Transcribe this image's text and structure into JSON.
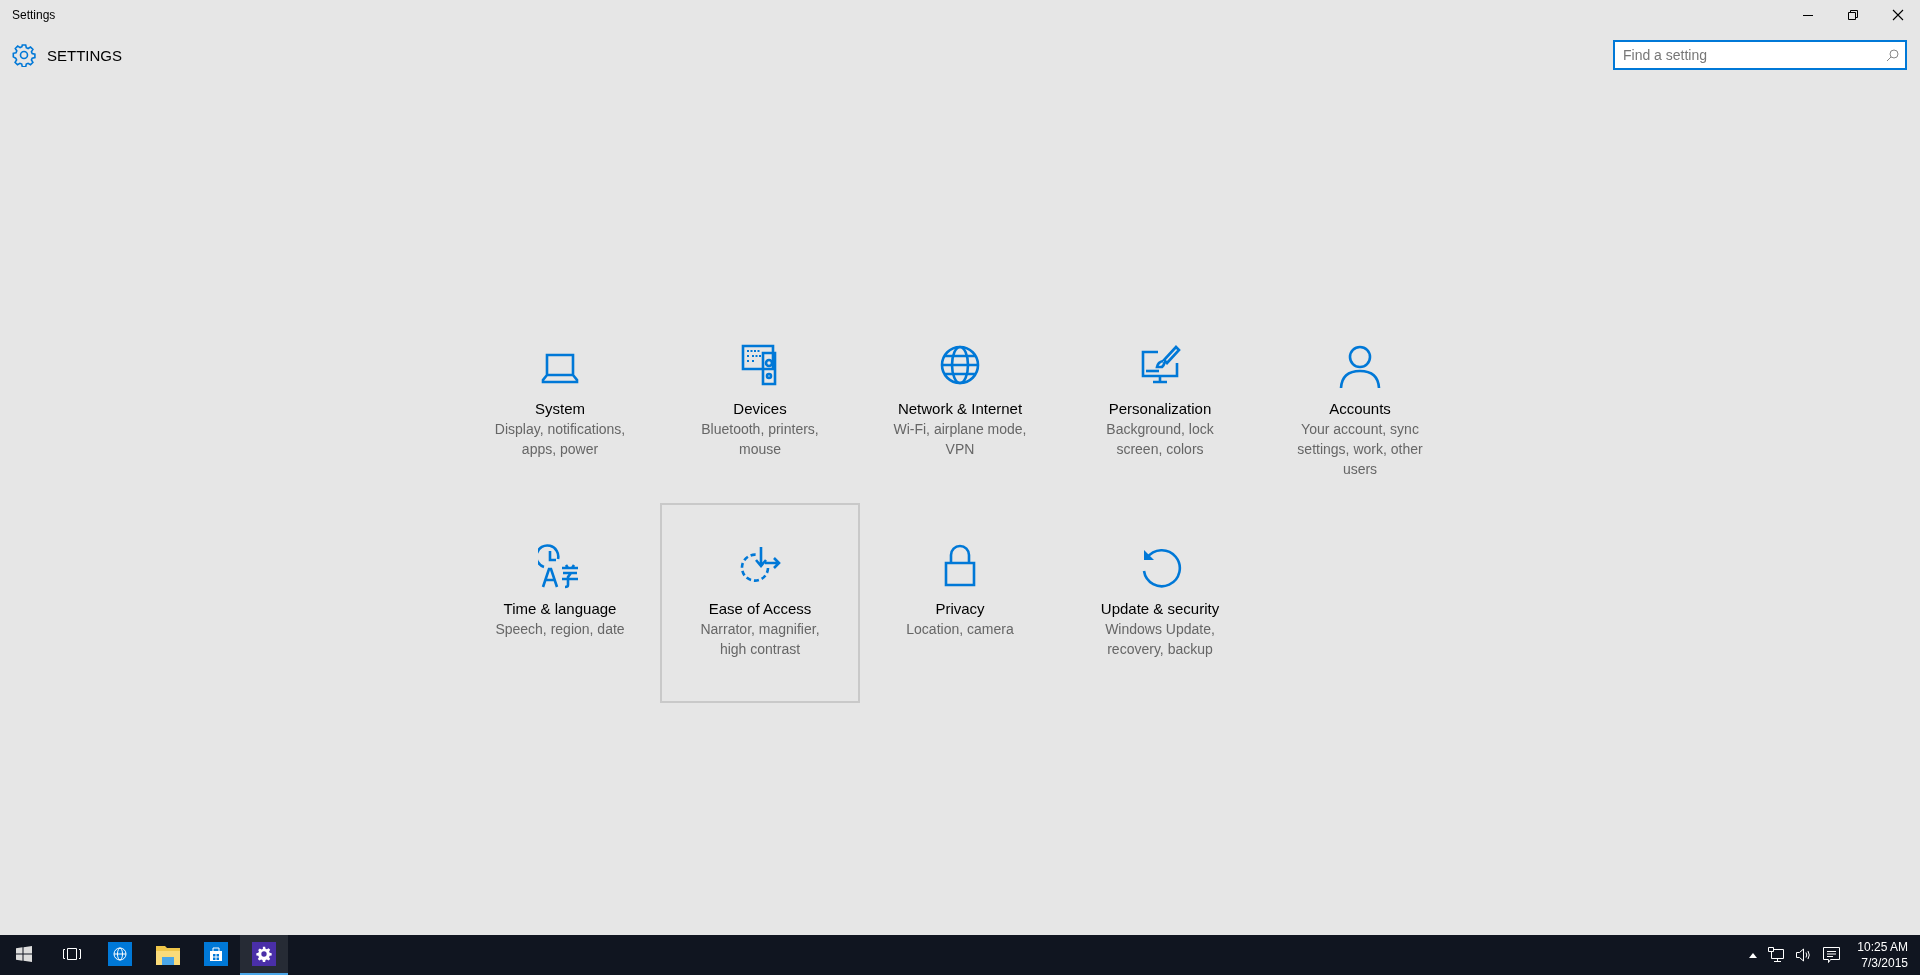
{
  "window": {
    "title": "Settings"
  },
  "header": {
    "title": "SETTINGS"
  },
  "search": {
    "placeholder": "Find a setting"
  },
  "categories": [
    {
      "title": "System",
      "description": "Display, notifications, apps, power",
      "selected": false
    },
    {
      "title": "Devices",
      "description": "Bluetooth, printers, mouse",
      "selected": false
    },
    {
      "title": "Network & Internet",
      "description": "Wi-Fi, airplane mode, VPN",
      "selected": false
    },
    {
      "title": "Personalization",
      "description": "Background, lock screen, colors",
      "selected": false
    },
    {
      "title": "Accounts",
      "description": "Your account, sync settings, work, other users",
      "selected": false
    },
    {
      "title": "Time & language",
      "description": "Speech, region, date",
      "selected": false
    },
    {
      "title": "Ease of Access",
      "description": "Narrator, magnifier, high contrast",
      "selected": true
    },
    {
      "title": "Privacy",
      "description": "Location, camera",
      "selected": false
    },
    {
      "title": "Update & security",
      "description": "Windows Update, recovery, backup",
      "selected": false
    }
  ],
  "taskbar": {
    "apps": [
      {
        "selected": false
      },
      {
        "selected": false
      },
      {
        "selected": false
      },
      {
        "selected": false
      },
      {
        "selected": true
      }
    ],
    "clock": {
      "time": "10:25 AM",
      "date": "7/3/2015"
    }
  }
}
